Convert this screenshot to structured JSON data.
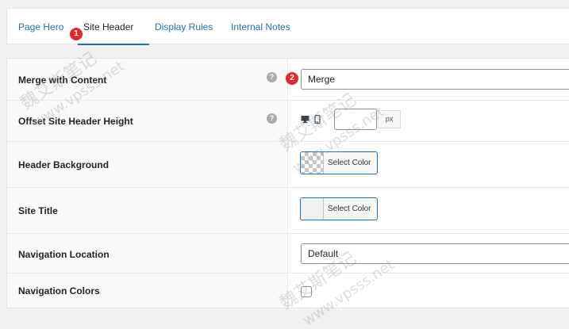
{
  "tabs": [
    {
      "label": "Page Hero",
      "active": false
    },
    {
      "label": "Site Header",
      "active": true
    },
    {
      "label": "Display Rules",
      "active": false
    },
    {
      "label": "Internal Notes",
      "active": false
    }
  ],
  "badges": {
    "first": "1",
    "second": "2"
  },
  "fields": {
    "merge_with_content": {
      "label": "Merge with Content",
      "help": "?",
      "value": "Merge"
    },
    "offset_header_height": {
      "label": "Offset Site Header Height",
      "help": "?",
      "value": "",
      "unit": "px",
      "desktop_icon": "desktop-icon",
      "mobile_icon": "mobile-icon"
    },
    "header_background": {
      "label": "Header Background",
      "button_label": "Select Color",
      "swatch": "transparent"
    },
    "site_title": {
      "label": "Site Title",
      "button_label": "Select Color",
      "swatch": "#eef0f2"
    },
    "navigation_location": {
      "label": "Navigation Location",
      "value": "Default"
    },
    "navigation_colors": {
      "label": "Navigation Colors",
      "checked": false
    }
  },
  "watermark": {
    "chinese": "魏艾斯笔记",
    "url": "www.vpsss.net"
  },
  "colors": {
    "link": "#2271b1",
    "badge": "#e0282f",
    "help": "#a7aaad"
  }
}
